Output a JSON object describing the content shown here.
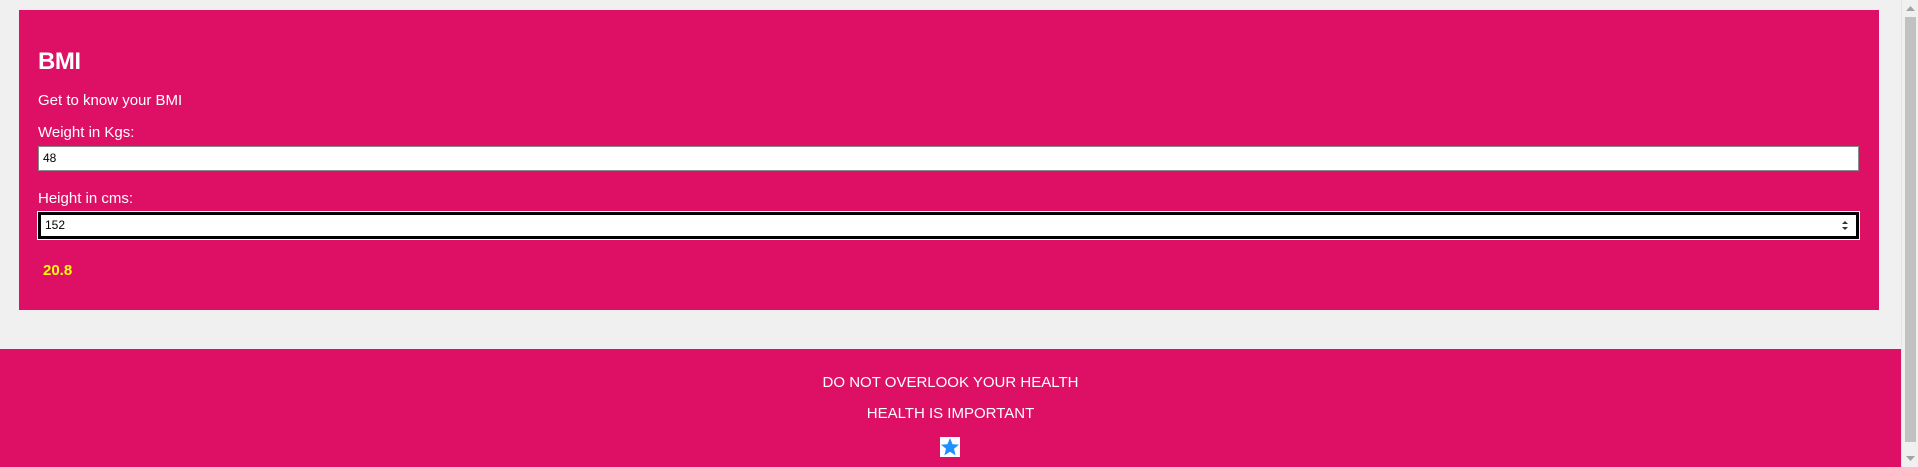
{
  "card": {
    "title": "BMI",
    "subtitle": "Get to know your BMI",
    "weight_label": "Weight in Kgs:",
    "weight_value": "48",
    "height_label": "Height in cms:",
    "height_value": "152",
    "result": "20.8"
  },
  "footer": {
    "line1": "DO NOT OVERLOOK YOUR HEALTH",
    "line2": "HEALTH IS IMPORTANT",
    "icon": "star-icon"
  },
  "colors": {
    "accent": "#dd1066",
    "background": "#f0f0f0",
    "result_text": "#ffff00",
    "star": "#1e90ff"
  }
}
